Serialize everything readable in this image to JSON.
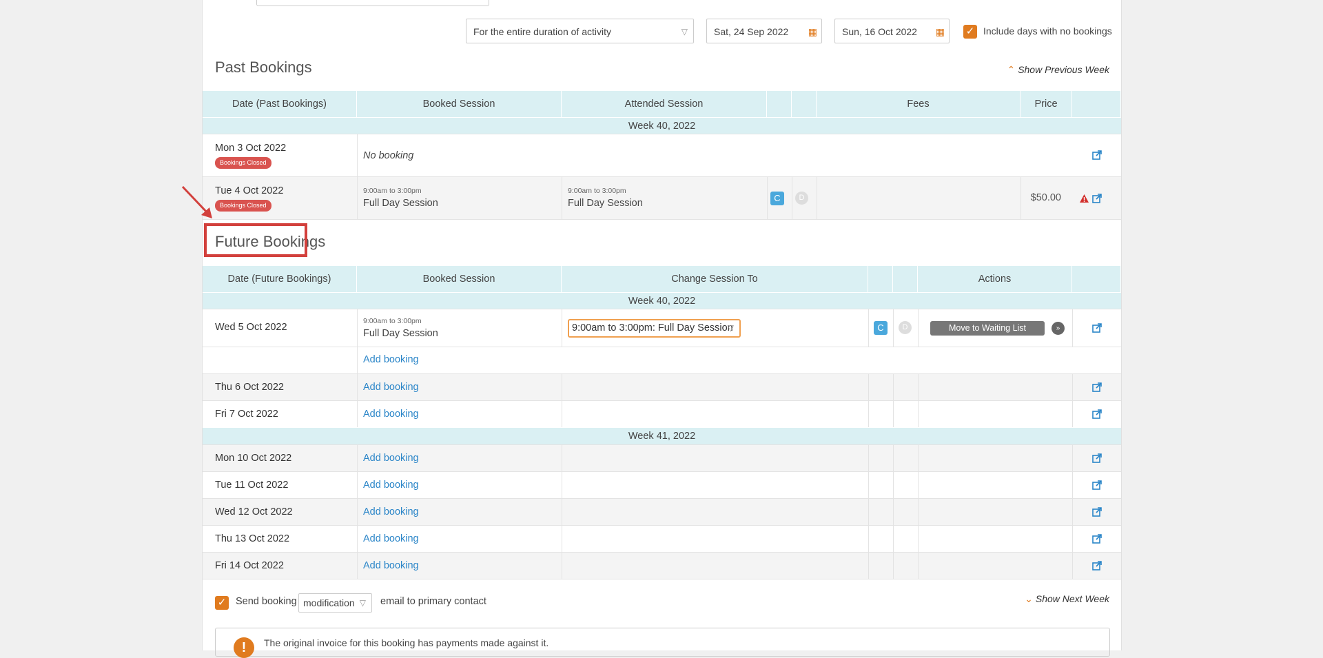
{
  "filters": {
    "duration_select": "For the entire duration of activity",
    "start_date": "Sat, 24 Sep 2022",
    "end_date": "Sun, 16 Oct 2022",
    "include_no_bookings_label": "Include days with no bookings"
  },
  "past": {
    "title": "Past Bookings",
    "show_previous": "Show Previous Week",
    "headers": {
      "date": "Date (Past Bookings)",
      "booked": "Booked Session",
      "attended": "Attended Session",
      "fees": "Fees",
      "price": "Price"
    },
    "week_label": "Week 40, 2022",
    "rows": [
      {
        "date": "Mon 3 Oct 2022",
        "badge": "Bookings Closed",
        "booked": "No booking"
      },
      {
        "date": "Tue 4 Oct 2022",
        "badge": "Bookings Closed",
        "booked_time": "9:00am to 3:00pm",
        "booked_name": "Full Day Session",
        "attended_time": "9:00am to 3:00pm",
        "attended_name": "Full Day Session",
        "c_label": "C",
        "d_label": "D",
        "price": "$50.00"
      }
    ]
  },
  "future": {
    "title": "Future Bookings",
    "headers": {
      "date": "Date (Future Bookings)",
      "booked": "Booked Session",
      "change": "Change Session To",
      "actions": "Actions"
    },
    "week40_label": "Week 40, 2022",
    "week41_label": "Week 41, 2022",
    "first_row": {
      "date": "Wed 5 Oct 2022",
      "booked_time": "9:00am to 3:00pm",
      "booked_name": "Full Day Session",
      "change_select": "9:00am to 3:00pm: Full Day Session",
      "c_label": "C",
      "d_label": "D",
      "waiting_button": "Move to Waiting List"
    },
    "add_booking": "Add booking",
    "dates": [
      "Thu 6 Oct 2022",
      "Fri 7 Oct 2022",
      "Mon 10 Oct 2022",
      "Tue 11 Oct 2022",
      "Wed 12 Oct 2022",
      "Thu 13 Oct 2022",
      "Fri 14 Oct 2022"
    ]
  },
  "footer": {
    "send_booking": "Send booking",
    "email_type": "modification",
    "email_suffix": "email to primary contact",
    "show_next": "Show Next Week",
    "notice": "The original invoice for this booking has payments made against it."
  },
  "colors": {
    "accent": "#e07b1f",
    "header_bg": "#daf0f3",
    "link": "#2a85c8",
    "badge": "#d9534f",
    "annotation": "#d2403c"
  }
}
